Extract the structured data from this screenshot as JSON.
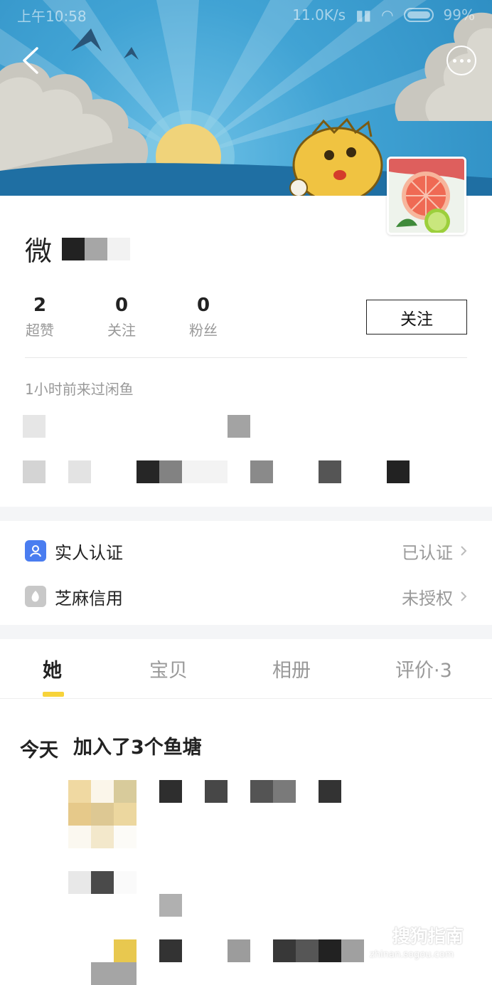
{
  "statusbar": {
    "time": "上午10:58",
    "network": "11.0K/s",
    "battery": "99%"
  },
  "header": {
    "back_icon": "chevron-left-icon",
    "more_icon": "more-dots-icon"
  },
  "profile": {
    "name": "微",
    "stats": [
      {
        "value": "2",
        "label": "超赞"
      },
      {
        "value": "0",
        "label": "关注"
      },
      {
        "value": "0",
        "label": "粉丝"
      }
    ],
    "follow_label": "关注",
    "last_visit": "1小时前来过闲鱼"
  },
  "verification": [
    {
      "label": "实人认证",
      "status": "已认证",
      "icon": "person-verify-icon",
      "color": "#4a7df0"
    },
    {
      "label": "芝麻信用",
      "status": "未授权",
      "icon": "sesame-credit-icon",
      "color": "#c8c8c8"
    }
  ],
  "tabs": [
    {
      "label": "她"
    },
    {
      "label": "宝贝"
    },
    {
      "label": "相册"
    },
    {
      "label": "评价·3"
    }
  ],
  "feed": {
    "day": "今天",
    "title": "加入了3个鱼塘"
  },
  "watermark": {
    "text": "搜狗指南",
    "url": "zhinan.sogou.com"
  },
  "colors": {
    "accent": "#f7d33a",
    "sky": "#3a9bd0",
    "divider": "#f4f5f7"
  }
}
